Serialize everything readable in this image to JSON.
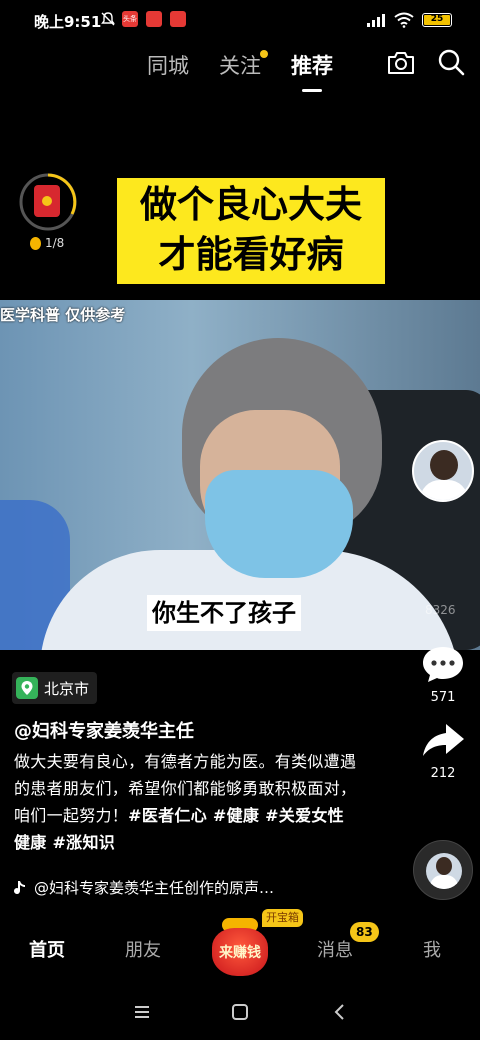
{
  "status_bar": {
    "time": "晚上9:51",
    "app_icon_1": "头条",
    "battery": "25"
  },
  "top_tabs": [
    {
      "label": "同城"
    },
    {
      "label": "关注"
    },
    {
      "label": "推荐"
    }
  ],
  "top_icons": [
    "camera-icon",
    "search-icon"
  ],
  "video": {
    "title_line1": "做个良心大夫",
    "title_line2": "才能看好病",
    "watermark": "医学科普 仅供参考",
    "subtitle": "你生不了孩子",
    "view_count": "8326"
  },
  "red_packet": {
    "progress_text": "1/8"
  },
  "rail": {
    "comment_count": "571",
    "share_count": "212"
  },
  "location": "北京市",
  "author": "@妇科专家姜羡华主任",
  "description": "做大夫要有良心，有德者方能为医。有类似遭遇的患者朋友们，希望你们都能够勇敢积极面对，咱们一起努力！",
  "hashtags": "#医者仁心 #健康 #关爱女性健康 #涨知识",
  "music": "@妇科专家姜羡华主任创作的原声…",
  "bottom_nav": {
    "home": "首页",
    "friends": "朋友",
    "earn": "来赚钱",
    "earn_badge": "开宝箱",
    "messages": "消息",
    "messages_badge": "83",
    "me": "我"
  },
  "colors": {
    "highlight_yellow": "#fde81e",
    "badge_yellow": "#f5c518",
    "red": "#d7282f",
    "green_pin": "#35b35a"
  }
}
